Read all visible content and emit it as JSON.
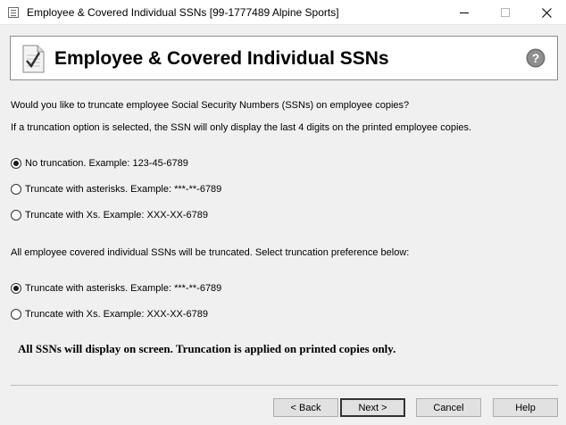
{
  "window": {
    "title": "Employee & Covered Individual SSNs [99-1777489 Alpine Sports]"
  },
  "header": {
    "title": "Employee & Covered Individual SSNs",
    "icon": "clipboard-check-icon",
    "help_icon": "help-icon"
  },
  "intro": {
    "question": "Would you like to truncate employee Social Security Numbers (SSNs) on employee copies?",
    "explanation": "If a truncation option is selected, the SSN will only display the last 4 digits on the printed employee copies."
  },
  "employee_options": [
    {
      "label": "No truncation. Example: 123-45-6789",
      "checked": true
    },
    {
      "label": "Truncate with asterisks. Example: ***-**-6789",
      "checked": false
    },
    {
      "label": "Truncate with Xs. Example: XXX-XX-6789",
      "checked": false
    }
  ],
  "covered_section": {
    "text": "All employee covered individual SSNs will be truncated. Select truncation preference below:"
  },
  "covered_options": [
    {
      "label": "Truncate with asterisks. Example: ***-**-6789",
      "checked": true
    },
    {
      "label": "Truncate with Xs. Example: XXX-XX-6789",
      "checked": false
    }
  ],
  "note": "All SSNs will display on screen. Truncation is applied on printed copies only.",
  "buttons": {
    "back": "< Back",
    "next": "Next >",
    "cancel": "Cancel",
    "help": "Help"
  }
}
